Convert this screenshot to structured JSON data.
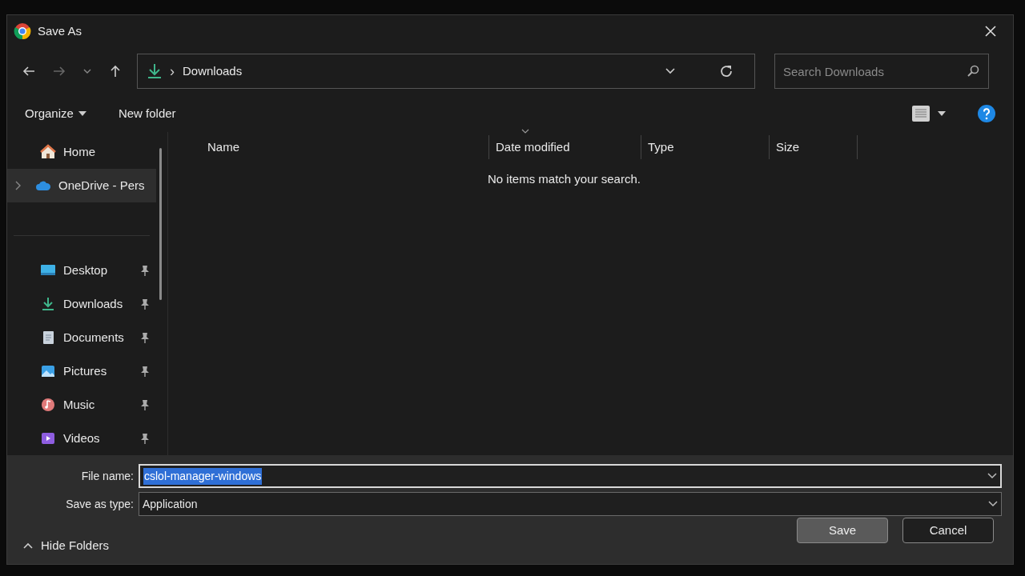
{
  "window": {
    "title": "Save As"
  },
  "address": {
    "separator": "›",
    "path": [
      "Downloads"
    ]
  },
  "search": {
    "placeholder": "Search Downloads"
  },
  "toolbar": {
    "organize": "Organize",
    "new_folder": "New folder"
  },
  "sidebar": {
    "items": [
      {
        "label": "Home",
        "kind": "home",
        "pinned": false,
        "selected": false,
        "expandable": false
      },
      {
        "label": "OneDrive - Pers",
        "kind": "cloud",
        "pinned": false,
        "selected": true,
        "expandable": true
      },
      {
        "label": "Desktop",
        "kind": "desktop",
        "pinned": true,
        "selected": false,
        "expandable": false
      },
      {
        "label": "Downloads",
        "kind": "download",
        "pinned": true,
        "selected": false,
        "expandable": false
      },
      {
        "label": "Documents",
        "kind": "document",
        "pinned": true,
        "selected": false,
        "expandable": false
      },
      {
        "label": "Pictures",
        "kind": "picture",
        "pinned": true,
        "selected": false,
        "expandable": false
      },
      {
        "label": "Music",
        "kind": "music",
        "pinned": true,
        "selected": false,
        "expandable": false
      },
      {
        "label": "Videos",
        "kind": "video",
        "pinned": true,
        "selected": false,
        "expandable": false
      }
    ]
  },
  "table": {
    "columns": [
      {
        "label": "Name",
        "sorted": false
      },
      {
        "label": "Date modified",
        "sorted": true
      },
      {
        "label": "Type",
        "sorted": false
      },
      {
        "label": "Size",
        "sorted": false
      }
    ],
    "empty_message": "No items match your search."
  },
  "file_name": {
    "label": "File name:",
    "value": "cslol-manager-windows",
    "text_selected": true
  },
  "save_as_type": {
    "label": "Save as type:",
    "value": "Application"
  },
  "hide_folders": {
    "label": "Hide Folders",
    "expanded": true
  },
  "buttons": [
    {
      "label": "Save",
      "default": true
    },
    {
      "label": "Cancel",
      "default": false
    }
  ]
}
